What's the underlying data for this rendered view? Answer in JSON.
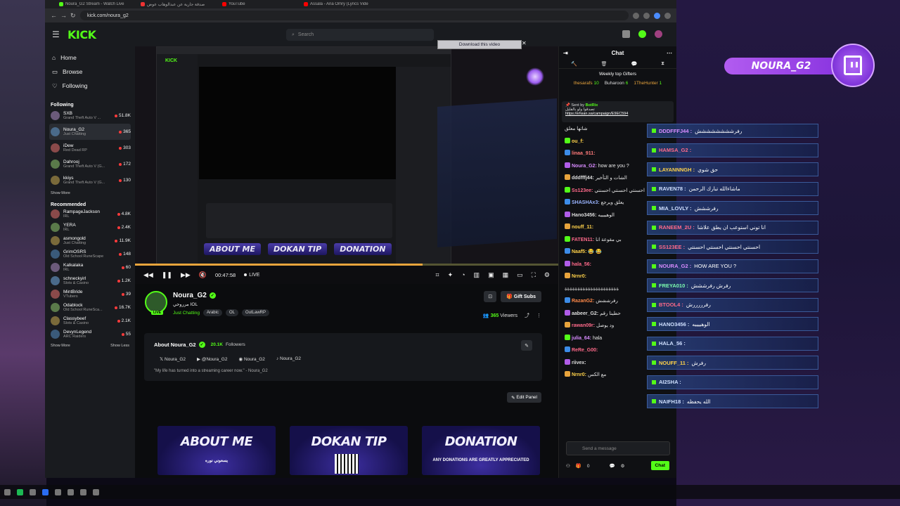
{
  "browser": {
    "tabs": [
      "Noura_G2 Stream - Watch Live",
      "صدقة جارية عن عبدالوهاب عوض",
      "YouTube",
      "Assala - Ana Omry (Lyrics Vide"
    ],
    "url": "kick.com/noura_g2"
  },
  "topnav": {
    "logo": "KICK",
    "search_placeholder": "Search"
  },
  "sidebar": {
    "nav": [
      {
        "label": "Home"
      },
      {
        "label": "Browse"
      },
      {
        "label": "Following"
      }
    ],
    "following_title": "Following",
    "following": [
      {
        "name": "SXB",
        "category": "Grand Theft Auto V ...",
        "viewers": "51.8K"
      },
      {
        "name": "Noura_G2",
        "category": "Just Chatting",
        "viewers": "365"
      },
      {
        "name": "iDew",
        "category": "Red Dead RP",
        "viewers": "303"
      },
      {
        "name": "Dahrooj",
        "category": "Grand Theft Auto V (G...",
        "viewers": "172"
      },
      {
        "name": "kkiys",
        "category": "Grand Theft Auto V (G...",
        "viewers": "130"
      }
    ],
    "show_more": "Show More",
    "recommended_title": "Recommended",
    "recommended": [
      {
        "name": "RampageJackson",
        "category": "IRL",
        "viewers": "4.8K"
      },
      {
        "name": "YERA",
        "category": "IRL",
        "viewers": "2.4K"
      },
      {
        "name": "asmongold",
        "category": "Just Chatting",
        "viewers": "11.9K"
      },
      {
        "name": "GrimOSRS",
        "category": "Old School RuneScape",
        "viewers": "148"
      },
      {
        "name": "Kalkalaka",
        "category": "IRL",
        "viewers": "60"
      },
      {
        "name": "schneckyirl",
        "category": "Slots & Casino",
        "viewers": "1.2K"
      },
      {
        "name": "MintBride",
        "category": "VTubers",
        "viewers": "39"
      },
      {
        "name": "Odablock",
        "category": "Old School RuneSca...",
        "viewers": "16.7K"
      },
      {
        "name": "Classybeef",
        "category": "Slots & Casino",
        "viewers": "2.1K"
      },
      {
        "name": "DevynLegend",
        "category": "ARC Raiders",
        "viewers": "55"
      }
    ],
    "show_more2": "Show More",
    "show_less": "Show Less"
  },
  "video": {
    "download_label": "Download this video",
    "time": "00:47:58",
    "live_label": "LIVE",
    "progress_fraction": 0.68,
    "panels_mini": [
      "ABOUT ME",
      "DOKAN TIP",
      "DONATION"
    ]
  },
  "channel": {
    "name": "Noura_G2",
    "title": "مرروحي IOL",
    "category": "Just Chatting",
    "tags": [
      "Arabic",
      "OL",
      "OutLawRP"
    ],
    "live_badge": "LIVE",
    "gift_subs": "Gift Subs",
    "viewers": "365",
    "viewers_label": "Viewers",
    "about_title": "About Noura_G2",
    "followers": "20.1K",
    "followers_label": "Followers",
    "socials": [
      "Noura_G2",
      "@Noura_G2",
      "Noura_G2",
      "Noura_G2"
    ],
    "quote": "\"My life has turned into a streaming career now.\" - Noura_G2",
    "edit_panel": "Edit Panel",
    "panels": [
      {
        "title": "ABOUT ME",
        "sub": "يسعوني نوره"
      },
      {
        "title": "DOKAN TIP",
        "sub": ""
      },
      {
        "title": "DONATION",
        "sub": "ANY DONATIONS ARE GREATLY APPRECIATED"
      }
    ]
  },
  "chat": {
    "title": "Chat",
    "gifters_title": "Weekly top Gifters",
    "gifters": [
      {
        "name": "thesarafs",
        "count": "10"
      },
      {
        "name": "Buharoon",
        "count": "6"
      },
      {
        "name": "1TheHunter",
        "count": "1"
      }
    ],
    "pinned_sender": "Sent by",
    "pinned_bot": "BotRix",
    "pinned_text": "تصدقوا ولو بالقليل",
    "pinned_link": "https://ehsan.sa/campaign/E9EC594",
    "messages": [
      {
        "user": "",
        "text": "شاتها معلق",
        "color": "#ddd"
      },
      {
        "user": "ou_f:",
        "text": "",
        "color": "#ffd24a"
      },
      {
        "user": "linaa_911:",
        "text": "",
        "color": "#ff7a7a"
      },
      {
        "user": "Noura_G2:",
        "text": "how are you ?",
        "color": "#d88cff"
      },
      {
        "user": "dddfffj44:",
        "text": "الشات و التأخير",
        "color": "#ddd"
      },
      {
        "user": "Ss123ee:",
        "text": "احسنتي احسنتي احسنتي",
        "color": "#ff6a8a"
      },
      {
        "user": "SHASHAx3:",
        "text": "يعلق ويرجع",
        "color": "#9ab4ff"
      },
      {
        "user": "Hano3456:",
        "text": "الوهييييه",
        "color": "#ddd"
      },
      {
        "user": "nouff_11:",
        "text": "",
        "color": "#ffd24a"
      },
      {
        "user": "FATEN11:",
        "text": "بي مقوعة انا",
        "color": "#ff6a8a"
      },
      {
        "user": "Naaf5:",
        "text": "😂 😂",
        "color": "#ffd24a"
      },
      {
        "user": "hala_56:",
        "text": "",
        "color": "#ff6a8a"
      },
      {
        "user": "Nrnr0:",
        "text": "",
        "color": "#ffd24a"
      },
      {
        "user": "",
        "text": "ةةةةةةةةةةةةةةةةةةةةة",
        "color": "#ddd"
      },
      {
        "user": "RazanG2:",
        "text": "رفرششش",
        "color": "#ff8a4a"
      },
      {
        "user": "aabeer_G2:",
        "text": "حطينا رقم",
        "color": "#ddd"
      },
      {
        "user": "rawan09r:",
        "text": "ود يوصل",
        "color": "#ff6a8a"
      },
      {
        "user": "julia_64:",
        "text": "hala",
        "color": "#d88cff"
      },
      {
        "user": "ReRe_G00:",
        "text": "",
        "color": "#ff6a8a"
      },
      {
        "user": "riivex:",
        "text": "",
        "color": "#ddd"
      },
      {
        "user": "Nrnr0:",
        "text": "مع الكس",
        "color": "#ffd24a"
      }
    ],
    "input_placeholder": "Send a message",
    "points": "0",
    "send": "Chat"
  },
  "overlay": {
    "name": "NOURA_G2",
    "rows": [
      {
        "user": "DDDFFFJ44",
        "text": "رفرشششششششش",
        "color": "mod"
      },
      {
        "user": "HAMSA_G2",
        "text": "",
        "color": "red"
      },
      {
        "user": "LAYANNNGH",
        "text": "حق شوي",
        "color": "yel"
      },
      {
        "user": "RAVEN78",
        "text": "ماشاءالله تبارك الرحمن",
        "color": ""
      },
      {
        "user": "MIA_LOVLY",
        "text": "رفرششش",
        "color": ""
      },
      {
        "user": "RANEEM_2U",
        "text": "انا توني استوعب ان يطق علاشا",
        "color": "red"
      },
      {
        "user": "SS123EE",
        "text": "احسنتي احسنتي احسنتي احسنتي",
        "color": "red"
      },
      {
        "user": "NOURA_G2",
        "text": "HOW ARE YOU ?",
        "color": "mod"
      },
      {
        "user": "FREYA010",
        "text": "رفرش رفرششش",
        "color": "grn"
      },
      {
        "user": "BTOOL4",
        "text": "رفرررررش",
        "color": "red"
      },
      {
        "user": "HANO3456",
        "text": "الوهييييه",
        "color": ""
      },
      {
        "user": "HALA_56",
        "text": "",
        "color": ""
      },
      {
        "user": "NOUFF_11",
        "text": "رفرش",
        "color": "yel"
      },
      {
        "user": "AI2SHA",
        "text": "",
        "color": ""
      },
      {
        "user": "NAIFH18",
        "text": "الله يحفظه",
        "color": ""
      }
    ]
  }
}
